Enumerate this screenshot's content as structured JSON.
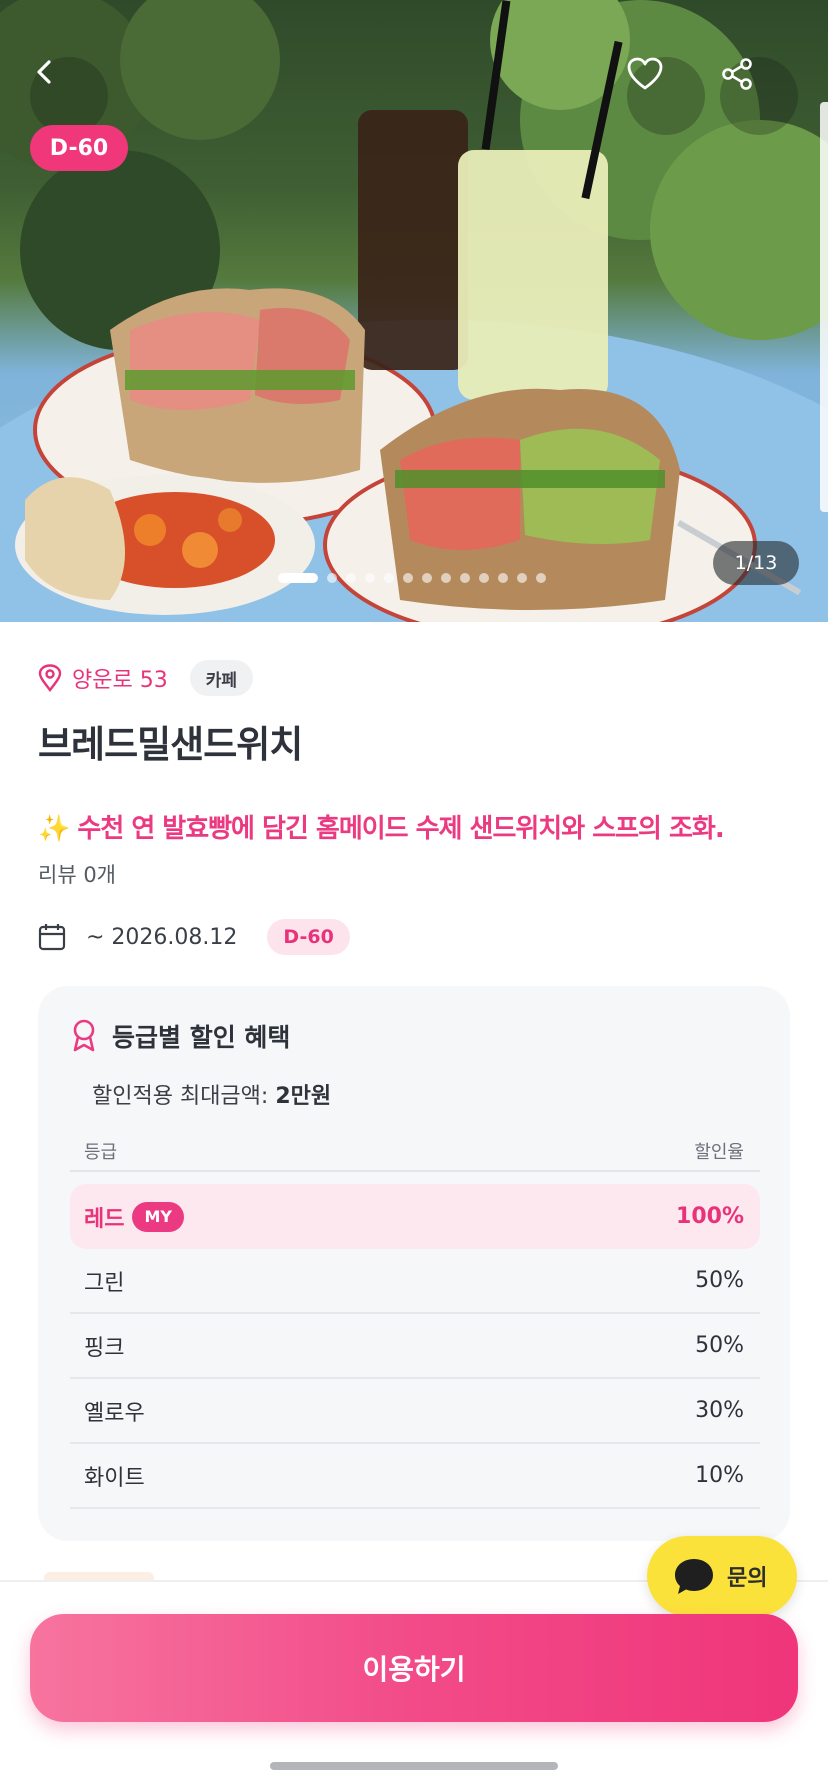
{
  "hero": {
    "dday_badge": "D-60",
    "counter": "1/13",
    "total_images": 13,
    "current_image": 1
  },
  "place": {
    "location": "양운로 53",
    "category": "카페",
    "title": "브레드밀샌드위치",
    "tagline": "✨ 수천 연 발효빵에 담긴 홈메이드 수제 샌드위치와 스프의 조화.",
    "review": "리뷰 0개",
    "period": "~ 2026.08.12",
    "dday": "D-60"
  },
  "benefits": {
    "title": "등급별 할인 혜택",
    "max_label": "할인적용 최대금액: ",
    "max_value": "2만원",
    "col_grade": "등급",
    "col_rate": "할인율",
    "my_badge": "MY",
    "rows": [
      {
        "grade": "레드",
        "rate": "100%"
      },
      {
        "grade": "그린",
        "rate": "50%"
      },
      {
        "grade": "핑크",
        "rate": "50%"
      },
      {
        "grade": "옐로우",
        "rate": "30%"
      },
      {
        "grade": "화이트",
        "rate": "10%"
      }
    ]
  },
  "actions": {
    "inquiry": "문의",
    "cta": "이용하기"
  },
  "colors": {
    "accent": "#ec3a82",
    "inquiry_bg": "#fbe23a"
  }
}
